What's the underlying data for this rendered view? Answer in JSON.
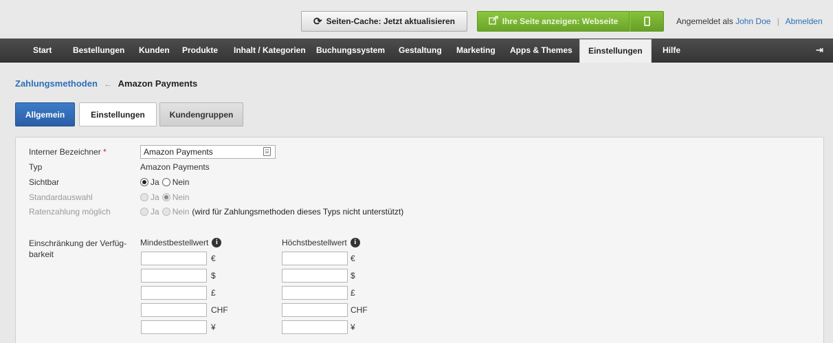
{
  "topbar": {
    "cache_button": "Seiten-Cache: Jetzt aktualisieren",
    "view_site_button": "Ihre Seite anzeigen: Webseite",
    "logged_in_prefix": "Angemeldet als",
    "user_name": "John Doe",
    "separator": "|",
    "logout": "Abmelden"
  },
  "nav": {
    "items": [
      "Start",
      "Bestellungen",
      "Kunden",
      "Produkte",
      "Inhalt / Kategorien",
      "Buchungssystem",
      "Gestaltung",
      "Marketing",
      "Apps & Themes",
      "Einstellungen",
      "Hilfe"
    ],
    "active": "Einstellungen"
  },
  "breadcrumb": {
    "parent": "Zahlungsmethoden",
    "arrow": "←",
    "current": "Amazon Payments"
  },
  "tabs": {
    "allgemein": "Allgemein",
    "einstellungen": "Einstellungen",
    "kundengruppen": "Kundengruppen",
    "active": "Allgemein"
  },
  "form": {
    "internal_name_label": "Interner Bezeichner",
    "required_mark": "*",
    "internal_name_value": "Amazon Payments",
    "type_label": "Typ",
    "type_value": "Amazon Payments",
    "visible_label": "Sichtbar",
    "yes": "Ja",
    "no": "Nein",
    "visible_value": "Ja",
    "default_label": "Standardauswahl",
    "default_value": "Nein",
    "installment_label": "Ratenzahlung möglich",
    "installment_note": "(wird für Zahlungsmethoden dieses Typs nicht unterstützt)",
    "restriction_label_1": "Einschränkung der Verfüg-",
    "restriction_label_2": "barkeit",
    "min_order_label": "Mindestbestellwert",
    "max_order_label": "Höchstbestellwert",
    "currencies": [
      "€",
      "$",
      "£",
      "CHF",
      "¥"
    ]
  }
}
